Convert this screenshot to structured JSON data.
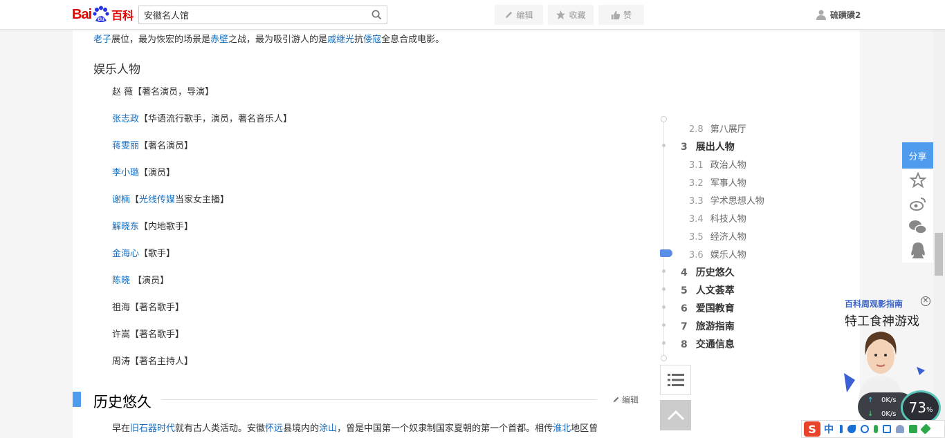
{
  "header": {
    "logo_bai": "Bai",
    "logo_du": "du",
    "logo_baike": "百科",
    "search_value": "安徽名人馆",
    "edit_label": "编辑",
    "favorite_label": "收藏",
    "like_label": "赞",
    "username": "硫磺磺2"
  },
  "article": {
    "intro": {
      "p1": "老子",
      "p2": "展位，最为恢宏的场景是",
      "p3": "赤壁",
      "p4": "之战，最为吸引游人的是",
      "p5": "戚继光",
      "p6": "抗",
      "p7": "倭寇",
      "p8": "全息合成电影。"
    },
    "section_title": "娱乐人物",
    "people": [
      {
        "name": "赵 薇",
        "desc": "【著名演员，导演】",
        "link": false
      },
      {
        "name": "张志政",
        "desc": "【华语流行歌手，演员，著名音乐人】",
        "link": true
      },
      {
        "name": "蒋雯丽",
        "desc": "【著名演员】",
        "link": true
      },
      {
        "name": "李小璐",
        "desc": "【演员】",
        "link": true
      },
      {
        "name": "谢楠",
        "desc": "【",
        "desc_link": "光线传媒",
        "desc_after": "当家女主播】",
        "link": true
      },
      {
        "name": "解晓东",
        "desc": "【内地歌手】",
        "link": true
      },
      {
        "name": "金海心",
        "desc": "【歌手】",
        "link": true
      },
      {
        "name": "陈晓",
        "desc": " 【演员】",
        "link": true
      },
      {
        "name": "祖海",
        "desc": "【著名歌手】",
        "link": false
      },
      {
        "name": "许嵩",
        "desc": "【著名歌手】",
        "link": false
      },
      {
        "name": "周涛",
        "desc": "【著名主持人】",
        "link": false
      }
    ],
    "h2_title": "历史悠久",
    "h2_edit": "编辑",
    "para": {
      "t1": "早在",
      "t2": "旧石器时代",
      "t3": "就有古人类活动。安徽",
      "t4": "怀远",
      "t5": "县境内的",
      "t6": "涂山",
      "t7": "，曾是中国第一个奴隶制国家夏朝的第一个首都。相传",
      "t8": "淮北",
      "t9": "地区曾"
    }
  },
  "catalog": {
    "items": [
      {
        "num": "2.8",
        "label": "第八展厅",
        "level": "sub"
      },
      {
        "num": "3",
        "label": "展出人物",
        "level": "main"
      },
      {
        "num": "3.1",
        "label": "政治人物",
        "level": "sub"
      },
      {
        "num": "3.2",
        "label": "军事人物",
        "level": "sub"
      },
      {
        "num": "3.3",
        "label": "学术思想人物",
        "level": "sub"
      },
      {
        "num": "3.4",
        "label": "科技人物",
        "level": "sub"
      },
      {
        "num": "3.5",
        "label": "经济人物",
        "level": "sub"
      },
      {
        "num": "3.6",
        "label": "娱乐人物",
        "level": "sub",
        "active": true
      },
      {
        "num": "4",
        "label": "历史悠久",
        "level": "main"
      },
      {
        "num": "5",
        "label": "人文荟萃",
        "level": "main"
      },
      {
        "num": "6",
        "label": "爱国教育",
        "level": "main"
      },
      {
        "num": "7",
        "label": "旅游指南",
        "level": "main"
      },
      {
        "num": "8",
        "label": "交通信息",
        "level": "main"
      }
    ]
  },
  "share": {
    "label": "分享"
  },
  "ad": {
    "tag": "百科周观影指南",
    "title": "特工食神游戏"
  },
  "net": {
    "up": "0",
    "up_unit": "K/s",
    "down": "0",
    "down_unit": "K/s",
    "percent": "73",
    "percent_sign": "%"
  },
  "ime": {
    "logo": "S",
    "mode": "中"
  },
  "colors": {
    "link": "#136ec2",
    "accent": "#4f9cee",
    "brand_red": "#e10601"
  }
}
